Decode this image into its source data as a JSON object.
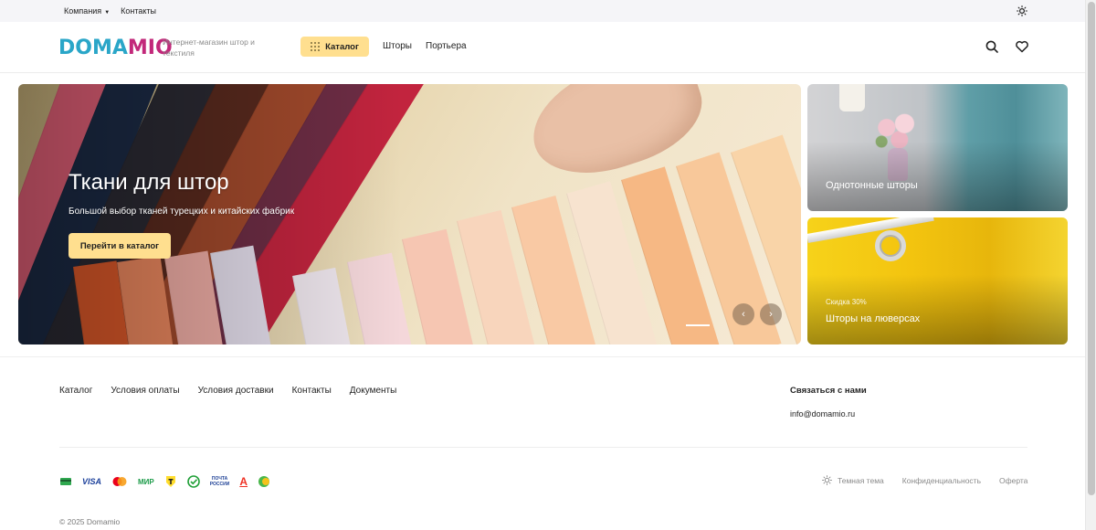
{
  "topbar": {
    "company_label": "Компания",
    "contacts_label": "Контакты"
  },
  "header": {
    "logo_part1": "DOMA",
    "logo_part2": "MIO",
    "tagline": "Интернет-магазин штор и текстиля",
    "catalog_button": "Каталог",
    "nav": [
      "Шторы",
      "Портьера"
    ]
  },
  "hero": {
    "title": "Ткани для штор",
    "subtitle": "Большой выбор тканей турецких и китайских фабрик",
    "button": "Перейти в каталог",
    "prev_arrow": "‹",
    "next_arrow": "›"
  },
  "cards": [
    {
      "title": "Однотонные шторы",
      "note": ""
    },
    {
      "title": "Шторы на люверсах",
      "note": "Скидка 30%"
    }
  ],
  "footer": {
    "links": [
      "Каталог",
      "Условия оплаты",
      "Условия доставки",
      "Контакты",
      "Документы"
    ],
    "contact_heading": "Связаться с нами",
    "contact_email": "info@domamio.ru",
    "payments": {
      "visa": "VISA",
      "mir": "МИР",
      "pochta_line1": "ПОЧТА",
      "pochta_line2": "РОССИИ",
      "alfa": "A"
    },
    "dark_theme": "Темная тема",
    "privacy": "Конфиденциальность",
    "offer": "Оферта",
    "copyright": "© 2025 Domamio"
  },
  "colors": {
    "accent_yellow": "#ffdf8f",
    "logo_blue": "#2aa6c8",
    "logo_magenta": "#c2287a"
  },
  "icons": [
    "sun-icon",
    "search-icon",
    "heart-icon",
    "grid-dots-icon",
    "chevron-left-icon",
    "chevron-right-icon"
  ]
}
